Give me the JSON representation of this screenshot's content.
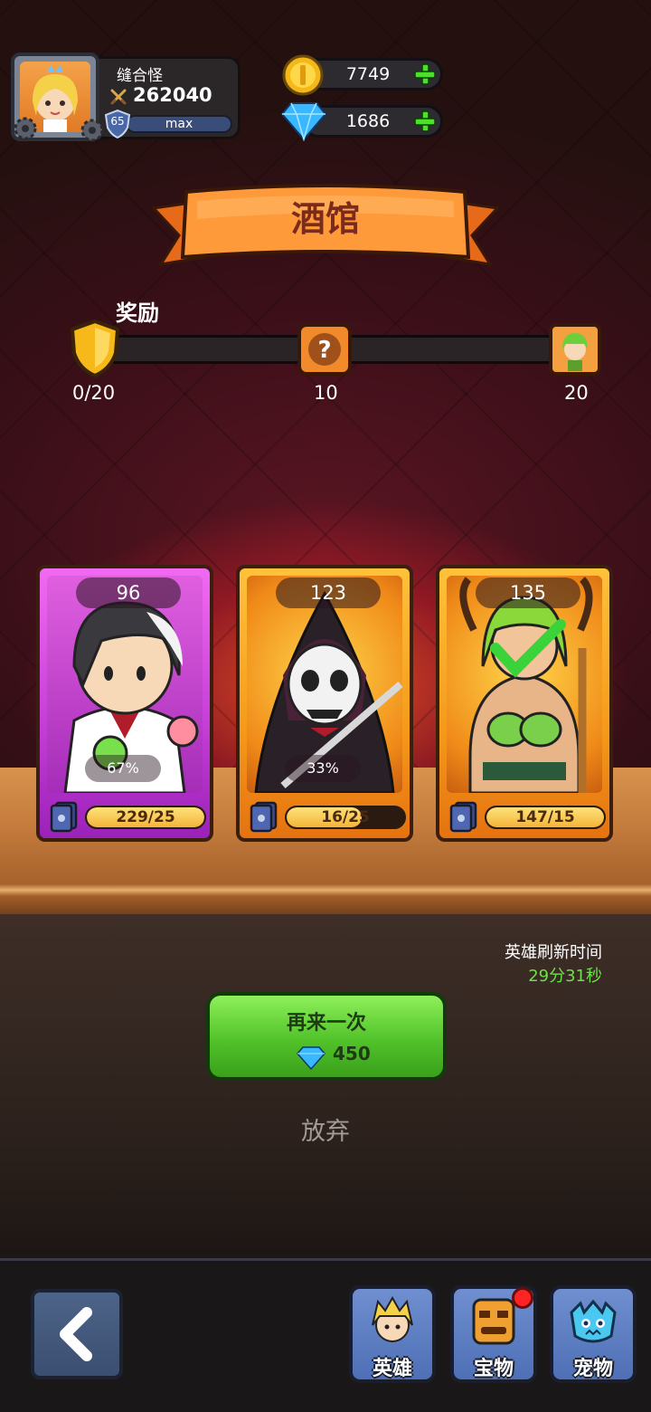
{
  "player": {
    "name": "缝合怪",
    "power": "262040",
    "level": "65",
    "level_bar_label": "max"
  },
  "currency": {
    "gold": "7749",
    "gems": "1686"
  },
  "banner": {
    "title": "酒馆"
  },
  "reward": {
    "label": "奖励",
    "progress": "0/20",
    "milestone_1": "10",
    "milestone_2": "20"
  },
  "cards": [
    {
      "rarity": "purple",
      "top_value": "96",
      "percent": "67%",
      "progress_text": "229/25",
      "progress_fill": 1.0
    },
    {
      "rarity": "orange",
      "top_value": "123",
      "percent": "33%",
      "progress_text": "16/25",
      "progress_fill": 0.64
    },
    {
      "rarity": "orange",
      "top_value": "135",
      "percent": "",
      "progress_text": "147/15",
      "progress_fill": 1.0
    }
  ],
  "refresh": {
    "label": "英雄刷新时间",
    "time": "29分31秒"
  },
  "again_button": {
    "label": "再来一次",
    "cost": "450"
  },
  "giveup": "放弃",
  "nav": {
    "heroes": "英雄",
    "treasure": "宝物",
    "pets": "宠物"
  },
  "colors": {
    "accent_green": "#52c22a",
    "refresh_time_color": "#6fe04a",
    "purple_card": "#c33cd6",
    "orange_card": "#f59a1a"
  }
}
